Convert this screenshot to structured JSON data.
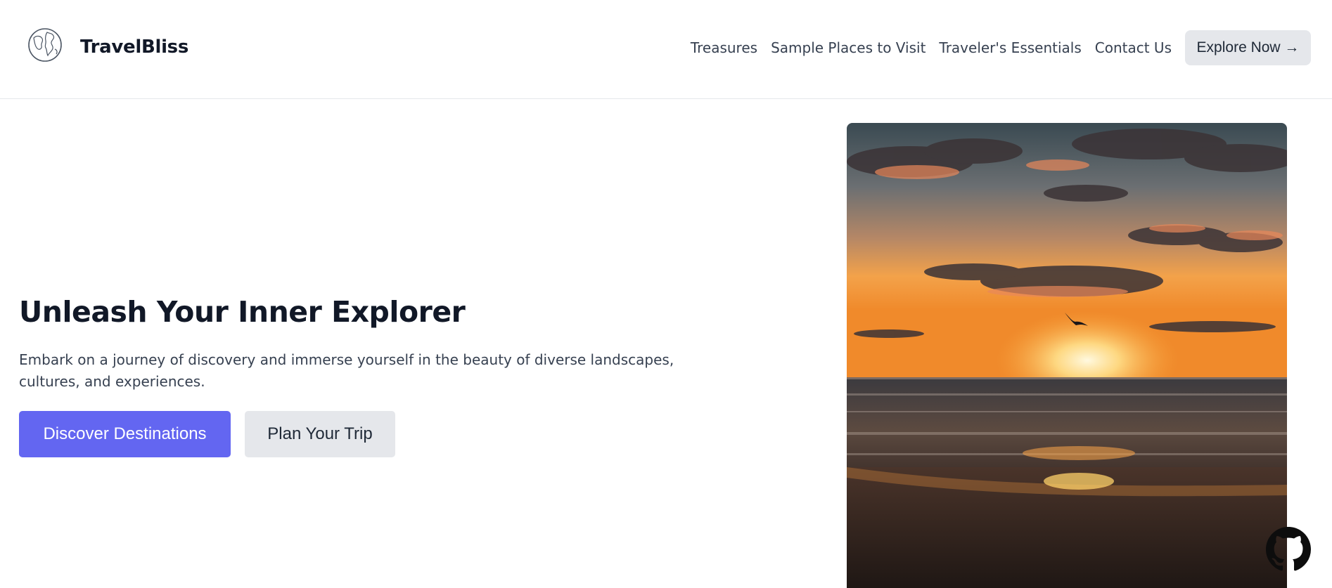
{
  "brand": {
    "name": "TravelBliss",
    "logo_icon": "globe-icon"
  },
  "nav": {
    "links": [
      "Treasures",
      "Sample Places to Visit",
      "Traveler's Essentials",
      "Contact Us"
    ],
    "cta_label": "Explore Now →"
  },
  "hero": {
    "title": "Unleash Your Inner Explorer",
    "description": "Embark on a journey of discovery and immerse yourself in the beauty of diverse landscapes, cultures, and experiences.",
    "primary_button": "Discover Destinations",
    "secondary_button": "Plan Your Trip",
    "image_icon": "sunset-beach-photo"
  },
  "floating": {
    "github_icon": "github-icon"
  },
  "colors": {
    "primary": "#6366f1",
    "secondary_bg": "#e5e7eb",
    "heading": "#111827",
    "text": "#374151"
  }
}
